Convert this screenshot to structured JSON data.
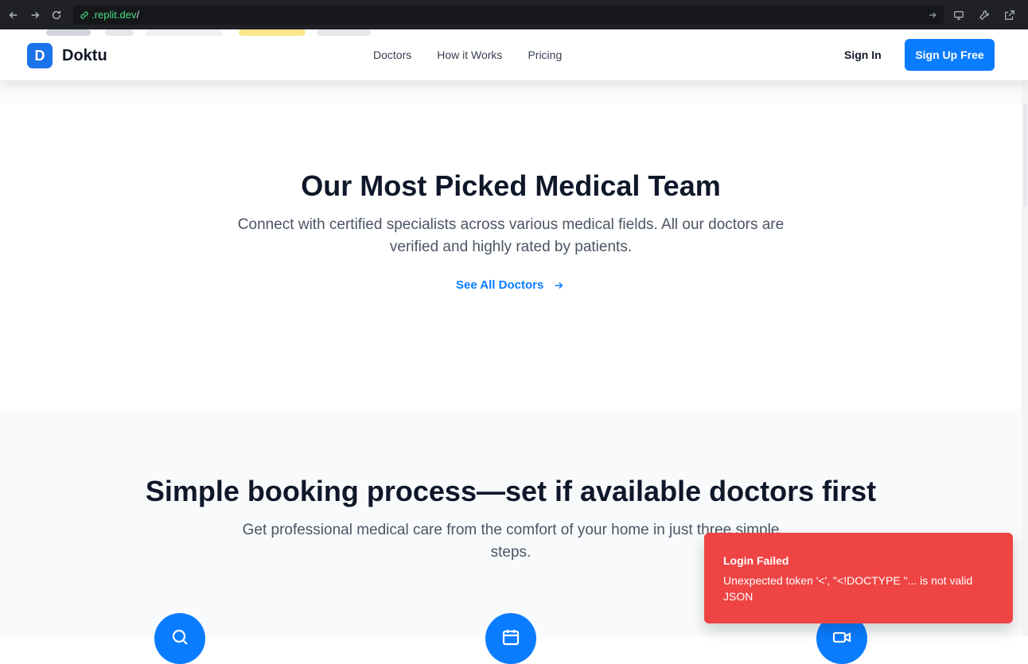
{
  "browser": {
    "url_domain": ".replit.dev",
    "url_path": "/"
  },
  "header": {
    "logo_letter": "D",
    "brand_name": "Doktu",
    "nav": [
      "Doctors",
      "How it Works",
      "Pricing"
    ],
    "sign_in": "Sign In",
    "sign_up": "Sign Up Free"
  },
  "team_section": {
    "title": "Our Most Picked Medical Team",
    "subtitle": "Connect with certified specialists across various medical fields. All our doctors are verified and highly rated by patients.",
    "see_all": "See All Doctors"
  },
  "steps_section": {
    "title": "Simple booking process—set if available doctors first",
    "subtitle": "Get professional medical care from the comfort of your home in just three simple steps.",
    "step_icons": [
      "search-icon",
      "calendar-icon",
      "video-icon"
    ]
  },
  "toast": {
    "title": "Login Failed",
    "message": "Unexpected token '<', \"<!DOCTYPE \"... is not valid JSON"
  },
  "colors": {
    "primary": "#0a7cff",
    "toast_bg": "#ef4444",
    "heading": "#0f172a",
    "body_text": "#4b5563",
    "steps_bg": "#f8fafc"
  }
}
